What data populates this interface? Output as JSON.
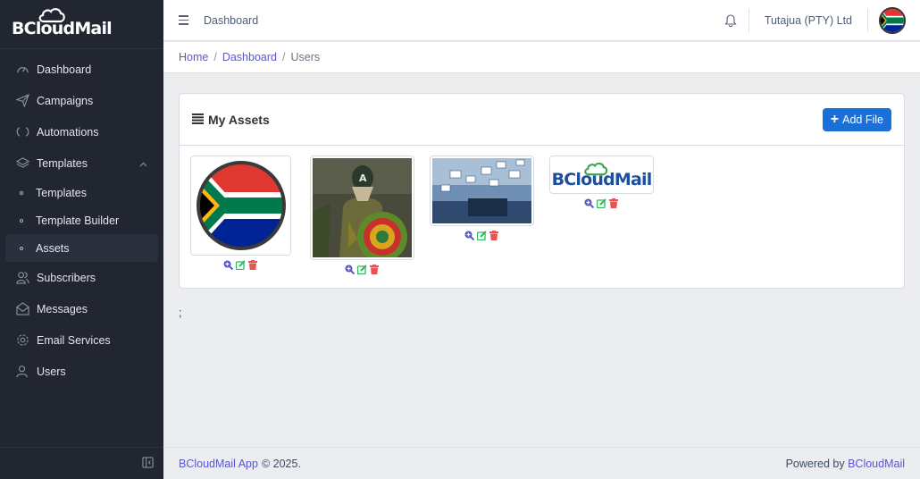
{
  "brand": {
    "name": "BCloudMail"
  },
  "sidebar": {
    "items": [
      {
        "label": "Dashboard",
        "icon": "speedometer-icon"
      },
      {
        "label": "Campaigns",
        "icon": "paper-plane-icon"
      },
      {
        "label": "Automations",
        "icon": "loop-icon"
      },
      {
        "label": "Templates",
        "icon": "layers-icon"
      },
      {
        "label": "Subscribers",
        "icon": "people-icon"
      },
      {
        "label": "Messages",
        "icon": "envelope-open-icon"
      },
      {
        "label": "Email Services",
        "icon": "gear-icon"
      },
      {
        "label": "Users",
        "icon": "user-icon"
      }
    ],
    "templates_sub": [
      {
        "label": "Templates"
      },
      {
        "label": "Template Builder"
      },
      {
        "label": "Assets",
        "active": true
      }
    ]
  },
  "header": {
    "title": "Dashboard",
    "org": "Tutajua (PTY) Ltd"
  },
  "breadcrumb": {
    "home": "Home",
    "sep": "/",
    "dashboard": "Dashboard",
    "current": "Users"
  },
  "card": {
    "title": "My Assets",
    "add_button": "Add File"
  },
  "assets": [
    {
      "name": "South Africa flag"
    },
    {
      "name": "Armoured hero"
    },
    {
      "name": "Email envelopes"
    },
    {
      "name": "BCloudMail logo",
      "logo_text": "BCloudMail"
    }
  ],
  "stray_text": ";",
  "footer": {
    "brand": "BCloudMail App",
    "copyright": "© 2025.",
    "powered_by": "Powered by",
    "powered_link": "BCloudMail"
  },
  "colors": {
    "sidebar_bg": "#212631",
    "primary": "#1a6fd8",
    "link": "#5856d6",
    "view": "#5856d6",
    "edit": "#2eb85c",
    "delete": "#e55353"
  }
}
